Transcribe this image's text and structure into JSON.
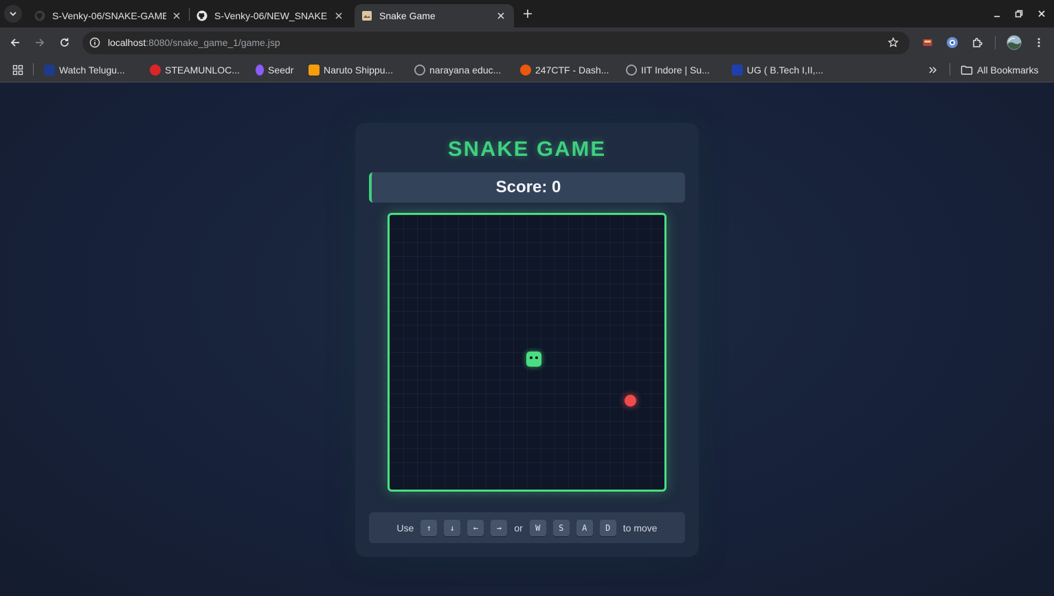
{
  "browser": {
    "tabs": [
      {
        "title": "S-Venky-06/SNAKE-GAME",
        "icon": "github-icon",
        "active": false
      },
      {
        "title": "S-Venky-06/NEW_SNAKE",
        "icon": "github-icon",
        "active": false
      },
      {
        "title": "Snake Game",
        "icon": "page-icon",
        "active": true
      }
    ],
    "url_host": "localhost",
    "url_rest": ":8080/snake_game_1/game.jsp",
    "bookmarks": [
      {
        "label": "Watch Telugu...",
        "color": "#1e3a8a"
      },
      {
        "label": "STEAMUNLOC...",
        "color": "#dc2626"
      },
      {
        "label": "Seedr",
        "color": "#8b5cf6"
      },
      {
        "label": "Naruto Shippu...",
        "color": "#f59e0b"
      },
      {
        "label": "narayana educ...",
        "color": "#9aa0a6"
      },
      {
        "label": "247CTF - Dash...",
        "color": "#ea580c"
      },
      {
        "label": "IIT Indore | Su...",
        "color": "#9aa0a6"
      },
      {
        "label": "UG ( B.Tech I,II,...",
        "color": "#1e40af"
      }
    ],
    "all_bookmarks_label": "All Bookmarks"
  },
  "game": {
    "title": "SNAKE GAME",
    "score_text": "Score: 0",
    "controls": {
      "use": "Use",
      "arrow_keys": [
        "↑",
        "↓",
        "←",
        "→"
      ],
      "or": "or",
      "letter_keys": [
        "W",
        "S",
        "A",
        "D"
      ],
      "to_move": "to move"
    },
    "colors": {
      "accent": "#4ade80",
      "food": "#f04b4b"
    }
  }
}
